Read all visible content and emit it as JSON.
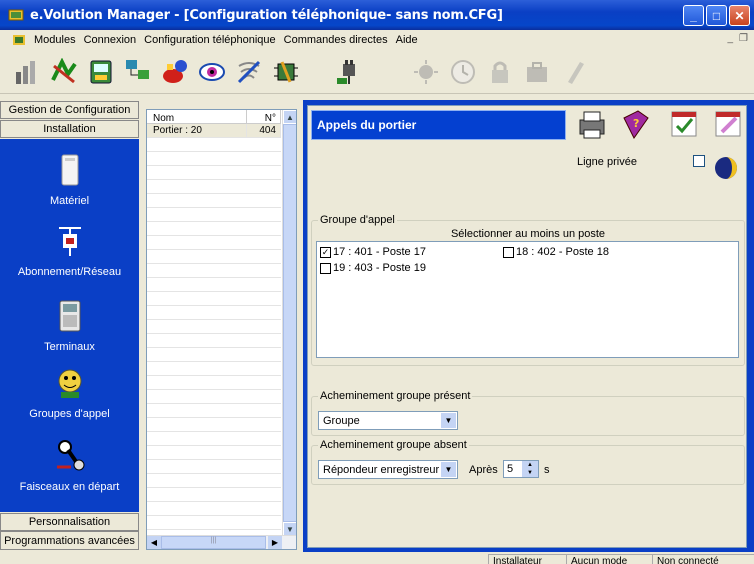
{
  "window": {
    "title": "e.Volution Manager - [Configuration téléphonique- sans nom.CFG]"
  },
  "menu": [
    "Modules",
    "Connexion",
    "Configuration téléphonique",
    "Commandes directes",
    "Aide"
  ],
  "toolbar_icons": [
    "modules-icon",
    "connect-icon",
    "phone-config-icon",
    "config-tree-icon",
    "paint-phone-icon",
    "view-eye-icon",
    "signal-icon",
    "network-chip-icon",
    "plug-icon",
    "sun-disabled-icon",
    "clock-disabled-icon",
    "lock-disabled-icon",
    "bag-disabled-icon",
    "phone-disabled-icon"
  ],
  "left": {
    "header": "Gestion de Configuration",
    "section": "Installation",
    "items": [
      {
        "label": "Matériel",
        "icon": "hardware-icon"
      },
      {
        "label": "Abonnement/Réseau",
        "icon": "network-plug-icon"
      },
      {
        "label": "Terminaux",
        "icon": "terminal-phone-icon"
      },
      {
        "label": "Groupes d'appel",
        "icon": "call-group-icon"
      },
      {
        "label": "Faisceaux en départ",
        "icon": "trunk-icon"
      }
    ],
    "footer1": "Personnalisation",
    "footer2": "Programmations avancées"
  },
  "list": {
    "columns": [
      "Nom",
      "N°"
    ],
    "rows": [
      {
        "name": "Portier : 20",
        "num": "404"
      }
    ]
  },
  "panel": {
    "title": "Appels du portier",
    "ligne_privee": "Ligne privée",
    "groupe_appel_legend": "Groupe d'appel",
    "select_hint": "Sélectionner au moins un poste",
    "postes": [
      {
        "label": "17 : 401  - Poste 17",
        "checked": true
      },
      {
        "label": "18 : 402  - Poste 18",
        "checked": false
      },
      {
        "label": "19 : 403  - Poste 19",
        "checked": false
      }
    ],
    "present_legend": "Acheminement groupe présent",
    "present_value": "Groupe",
    "absent_legend": "Acheminement groupe absent",
    "absent_value": "Répondeur enregistreur",
    "apres_label": "Après",
    "apres_value": "5",
    "apres_unit": "s"
  },
  "status": [
    "Installateur",
    "Aucun mode",
    "Non connecté"
  ]
}
